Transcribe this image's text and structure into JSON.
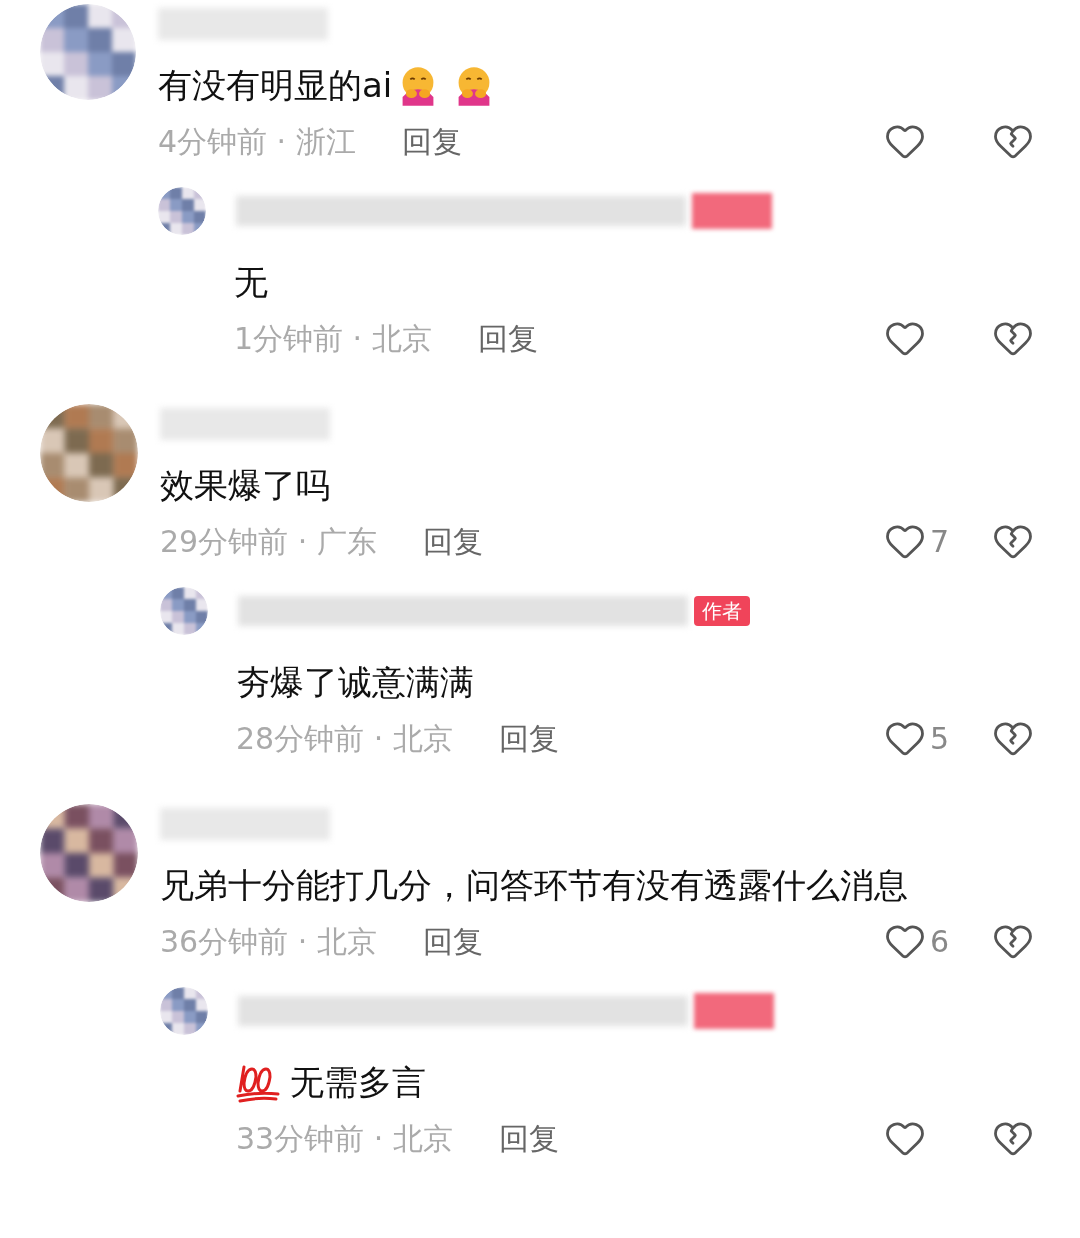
{
  "comments": [
    {
      "kind": "hug_emoji",
      "text": "有没有明显的ai",
      "time": "4分钟前 · 浙江",
      "reply": "回复",
      "replies": [
        {
          "kind": "plain",
          "author_badge": true,
          "text": "无",
          "time": "1分钟前 · 北京",
          "reply": "回复"
        }
      ]
    },
    {
      "kind": "plain",
      "text": "效果爆了吗",
      "time": "29分钟前 · 广东",
      "reply": "回复",
      "likes": "7",
      "replies": [
        {
          "kind": "plain",
          "author_badge": true,
          "badge": "作者",
          "text": "夯爆了诚意满满",
          "time": "28分钟前 · 北京",
          "reply": "回复",
          "likes": "5"
        }
      ]
    },
    {
      "kind": "plain",
      "text": "兄弟十分能打几分，问答环节有没有透露什么消息",
      "time": "36分钟前 · 北京",
      "reply": "回复",
      "likes": "6",
      "replies": [
        {
          "kind": "hundred_emoji",
          "author_badge": true,
          "text": "无需多言",
          "time": "33分钟前 · 北京",
          "reply": "回复"
        }
      ]
    }
  ]
}
